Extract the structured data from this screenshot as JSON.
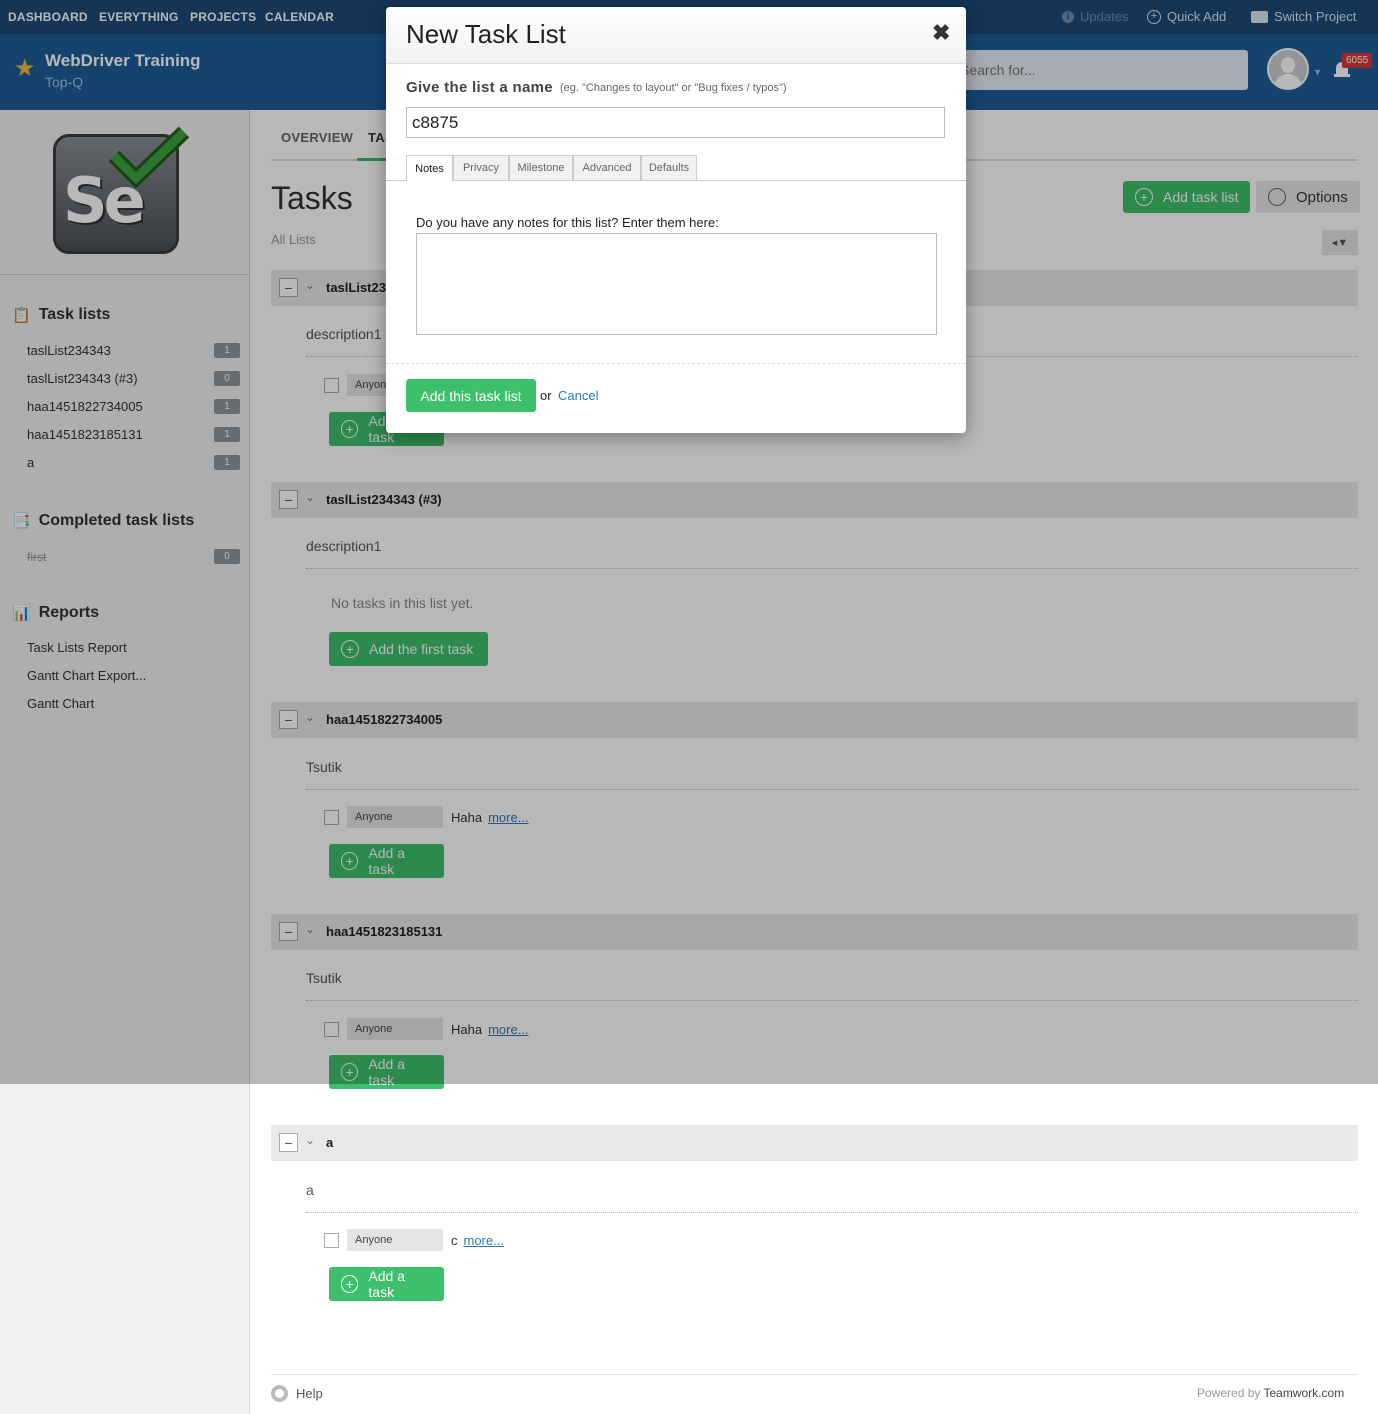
{
  "topnav": {
    "links": [
      "DASHBOARD",
      "EVERYTHING",
      "PROJECTS",
      "CALENDAR"
    ],
    "updates": "Updates",
    "quick_add": "Quick Add",
    "switch_project": "Switch Project"
  },
  "project": {
    "name": "WebDriver Training",
    "company": "Top-Q",
    "search_placeholder": "Search for...",
    "notification_count": "6055"
  },
  "sidebar": {
    "task_lists_heading": "Task lists",
    "task_lists": [
      {
        "label": "taslList234343",
        "count": "1"
      },
      {
        "label": "taslList234343 (#3)",
        "count": "0"
      },
      {
        "label": "haa1451822734005",
        "count": "1"
      },
      {
        "label": "haa1451823185131",
        "count": "1"
      },
      {
        "label": "a",
        "count": "1"
      }
    ],
    "completed_heading": "Completed task lists",
    "completed": [
      {
        "label": "first",
        "count": "0"
      }
    ],
    "reports_heading": "Reports",
    "reports": [
      "Task Lists Report",
      "Gantt Chart Export...",
      "Gantt Chart"
    ]
  },
  "main": {
    "tabs": [
      "OVERVIEW",
      "TASKS"
    ],
    "title": "Tasks",
    "all_lists": "All Lists",
    "add_task_list": "Add task list",
    "options": "Options",
    "lists": [
      {
        "name": "taslList234343",
        "description": "description1",
        "tasks": [
          {
            "assignee": "Anyone",
            "name": "",
            "more": ""
          }
        ],
        "add_label": "Add a task"
      },
      {
        "name": "taslList234343 (#3)",
        "description": "description1",
        "empty": "No tasks in this list yet.",
        "add_label": "Add the first task"
      },
      {
        "name": "haa1451822734005",
        "description": "Tsutik",
        "tasks": [
          {
            "assignee": "Anyone",
            "name": "Haha",
            "more": "more..."
          }
        ],
        "add_label": "Add a task"
      },
      {
        "name": "haa1451823185131",
        "description": "Tsutik",
        "tasks": [
          {
            "assignee": "Anyone",
            "name": "Haha",
            "more": "more..."
          }
        ],
        "add_label": "Add a task"
      },
      {
        "name": "a",
        "description": "a",
        "tasks": [
          {
            "assignee": "Anyone",
            "name": "c",
            "more": "more..."
          }
        ],
        "add_label": "Add a task"
      }
    ]
  },
  "footer": {
    "help": "Help",
    "powered_by": "Powered by",
    "brand": "Teamwork.com"
  },
  "modal": {
    "title": "New Task List",
    "close": "✖",
    "name_label": "Give the list a name",
    "name_hint": "(eg. \"Changes to layout\" or \"Bug fixes / typos\")",
    "name_value": "c8875",
    "tabs": [
      "Notes",
      "Privacy",
      "Milestone",
      "Advanced",
      "Defaults"
    ],
    "notes_label": "Do you have any notes for this list? Enter them here:",
    "notes_value": "",
    "submit": "Add this task list",
    "or": "or",
    "cancel": "Cancel"
  },
  "colors": {
    "nav_bg": "#1d4a78",
    "header_bg": "#1e5d99",
    "accent_green": "#3dbf6b",
    "link_blue": "#2b7bb9",
    "badge_red": "#d9373b"
  }
}
